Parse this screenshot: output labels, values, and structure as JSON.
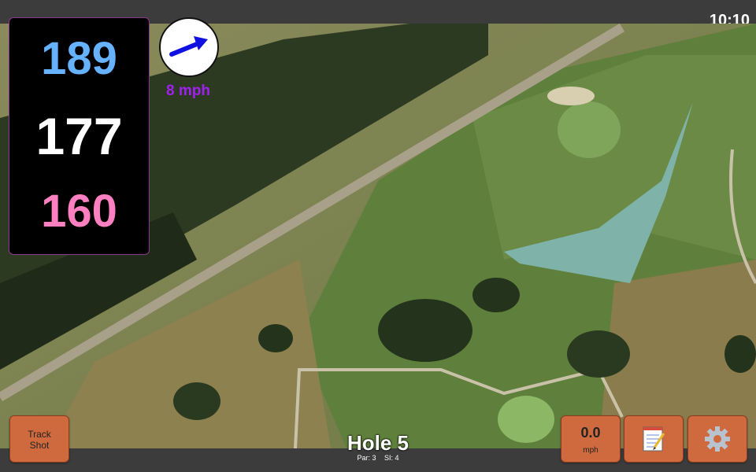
{
  "status": {
    "time": "10:10"
  },
  "distances": {
    "back": "189",
    "middle": "177",
    "front": "160"
  },
  "wind": {
    "speed": "8 mph",
    "icon": "wind-arrow-icon"
  },
  "buttons": {
    "track_shot_line1": "Track",
    "track_shot_line2": "Shot",
    "speed_value": "0.0",
    "speed_unit": "mph",
    "notes_icon": "notepad-icon",
    "settings_icon": "gear-icon"
  },
  "hole": {
    "title": "Hole 5",
    "par": "Par: 3",
    "si": "SI: 4"
  },
  "colors": {
    "back": "#66b2ff",
    "middle": "#ffffff",
    "front": "#ff80c0",
    "wind_text": "#a020f0",
    "button": "#cf6a3e"
  }
}
